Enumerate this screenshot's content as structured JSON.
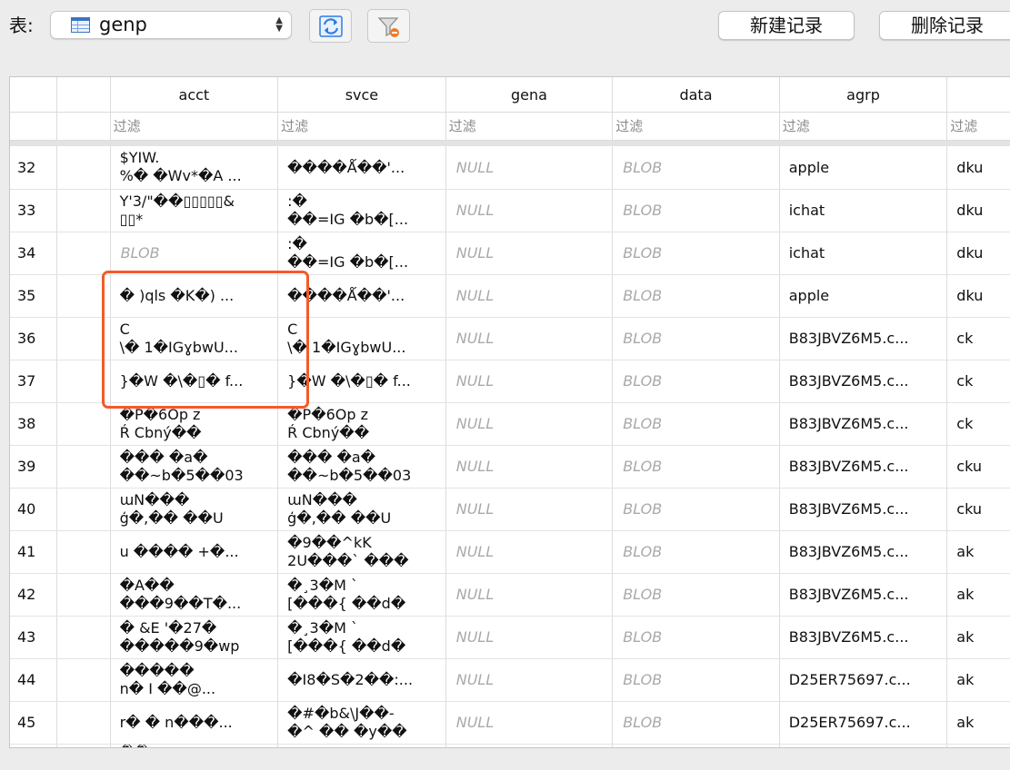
{
  "toolbar": {
    "table_label": "表:",
    "table_value": "genp",
    "new_record": "新建记录",
    "delete_record": "删除记录"
  },
  "icons": {
    "table": "table-icon",
    "refresh": "refresh-icon",
    "clear_filter": "clear-filter-icon"
  },
  "colors": {
    "highlight": "#f45a2a",
    "refresh_blue": "#2f7de0"
  },
  "grid": {
    "columns": [
      "acct",
      "svce",
      "gena",
      "data",
      "agrp"
    ],
    "filter_placeholder": "过滤",
    "rows": [
      {
        "n": "32",
        "acct": [
          "$YIW.",
          "%� �Wv*�A ..."
        ],
        "svce": [
          "����Ǻ��'..."
        ],
        "gena": "NULL",
        "data": "BLOB",
        "agrp": "apple",
        "extra": "dku"
      },
      {
        "n": "33",
        "acct": [
          "Y'3/\"��▯▯▯▯▯&",
          "▯▯*"
        ],
        "svce": [
          ":�",
          "��=IG �b�[..."
        ],
        "gena": "NULL",
        "data": "BLOB",
        "agrp": "ichat",
        "extra": "dku"
      },
      {
        "n": "34",
        "acct": "BLOB",
        "svce": [
          ":�",
          "��=IG �b�[..."
        ],
        "gena": "NULL",
        "data": "BLOB",
        "agrp": "ichat",
        "extra": "dku"
      },
      {
        "n": "35",
        "acct": [
          " � )qls �K�) ..."
        ],
        "svce": [
          "����Ǻ��'..."
        ],
        "gena": "NULL",
        "data": "BLOB",
        "agrp": "apple",
        "extra": "dku"
      },
      {
        "n": "36",
        "acct": [
          "C",
          "\\� 1�IGɣbwU..."
        ],
        "svce": [
          "C",
          "\\� 1�IGɣbwU..."
        ],
        "gena": "NULL",
        "data": "BLOB",
        "agrp": "B83JBVZ6M5.c...",
        "extra": "ck"
      },
      {
        "n": "37",
        "acct": [
          "}�W  �\\�▯� f..."
        ],
        "svce": [
          "}�W  �\\�▯� f..."
        ],
        "gena": "NULL",
        "data": "BLOB",
        "agrp": "B83JBVZ6M5.c...",
        "extra": "ck"
      },
      {
        "n": "38",
        "acct": [
          "�P�6Op z",
          "Ŕ Cbný��"
        ],
        "svce": [
          "�P�6Op z",
          "Ŕ Cbný��"
        ],
        "gena": "NULL",
        "data": "BLOB",
        "agrp": "B83JBVZ6M5.c...",
        "extra": "ck"
      },
      {
        "n": "39",
        "acct": [
          "���  �a�",
          "��~b�5��03"
        ],
        "svce": [
          "���  �a�",
          "��~b�5��03"
        ],
        "gena": "NULL",
        "data": "BLOB",
        "agrp": "B83JBVZ6M5.c...",
        "extra": "cku"
      },
      {
        "n": "40",
        "acct": [
          "ɯN���",
          "ģ�,�� ��U"
        ],
        "svce": [
          "ɯN���",
          "ģ�,�� ��U"
        ],
        "gena": "NULL",
        "data": "BLOB",
        "agrp": "B83JBVZ6M5.c...",
        "extra": "cku"
      },
      {
        "n": "41",
        "acct": [
          "u  ���� +�..."
        ],
        "svce": [
          "�9��^kK",
          "2U���` ���"
        ],
        "gena": "NULL",
        "data": "BLOB",
        "agrp": "B83JBVZ6M5.c...",
        "extra": "ak"
      },
      {
        "n": "42",
        "acct": [
          "�A��",
          "���9��T�..."
        ],
        "svce": [
          "�¸3�M `",
          "[���{ ��d�"
        ],
        "gena": "NULL",
        "data": "BLOB",
        "agrp": "B83JBVZ6M5.c...",
        "extra": "ak"
      },
      {
        "n": "43",
        "acct": [
          "� &E '�27�",
          "�����9�wp"
        ],
        "svce": [
          "�¸3�M `",
          "[���{ ��d�"
        ],
        "gena": "NULL",
        "data": "BLOB",
        "agrp": "B83JBVZ6M5.c...",
        "extra": "ak"
      },
      {
        "n": "44",
        "acct": [
          "�����",
          "n� I ��@..."
        ],
        "svce": [
          "�I8�S�2��:..."
        ],
        "gena": "NULL",
        "data": "BLOB",
        "agrp": "D25ER75697.c...",
        "extra": "ak"
      },
      {
        "n": "45",
        "acct": [
          "r�  � n���..."
        ],
        "svce": [
          "�#�b&\\J��-",
          "�^ �� �y��"
        ],
        "gena": "NULL",
        "data": "BLOB",
        "agrp": "D25ER75697.c...",
        "extra": "ak"
      },
      {
        "n": "",
        "acct": [
          "��"
        ],
        "svce": [
          ""
        ],
        "gena": "",
        "data": "",
        "agrp": "",
        "extra": ""
      }
    ]
  }
}
